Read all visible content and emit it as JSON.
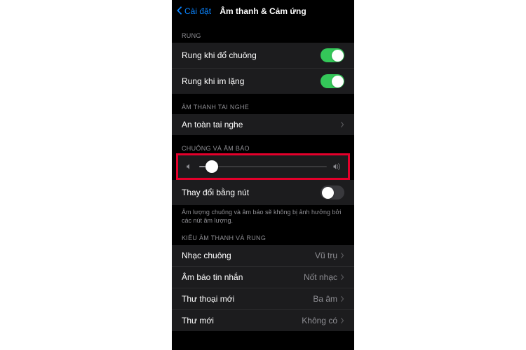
{
  "nav": {
    "back": "Cài đặt",
    "title": "Âm thanh & Cảm ứng"
  },
  "sections": {
    "rung": {
      "header": "RUNG",
      "items": [
        {
          "label": "Rung khi đổ chuông",
          "on": true
        },
        {
          "label": "Rung khi im lặng",
          "on": true
        }
      ]
    },
    "tainghe": {
      "header": "ÂM THANH TAI NGHE",
      "item": {
        "label": "An toàn tai nghe"
      }
    },
    "chuong": {
      "header": "CHUÔNG VÀ ÂM BÁO",
      "volume_percent": 10,
      "change_with_buttons": {
        "label": "Thay đổi bằng nút",
        "on": false
      },
      "footer": "Âm lượng chuông và âm báo sẽ không bị ảnh hưởng bởi các nút âm lượng."
    },
    "kieu": {
      "header": "KIỂU ÂM THANH VÀ RUNG",
      "items": [
        {
          "label": "Nhạc chuông",
          "value": "Vũ trụ"
        },
        {
          "label": "Âm báo tin nhắn",
          "value": "Nốt nhạc"
        },
        {
          "label": "Thư thoại mới",
          "value": "Ba âm"
        },
        {
          "label": "Thư mới",
          "value": "Không có"
        }
      ]
    }
  }
}
